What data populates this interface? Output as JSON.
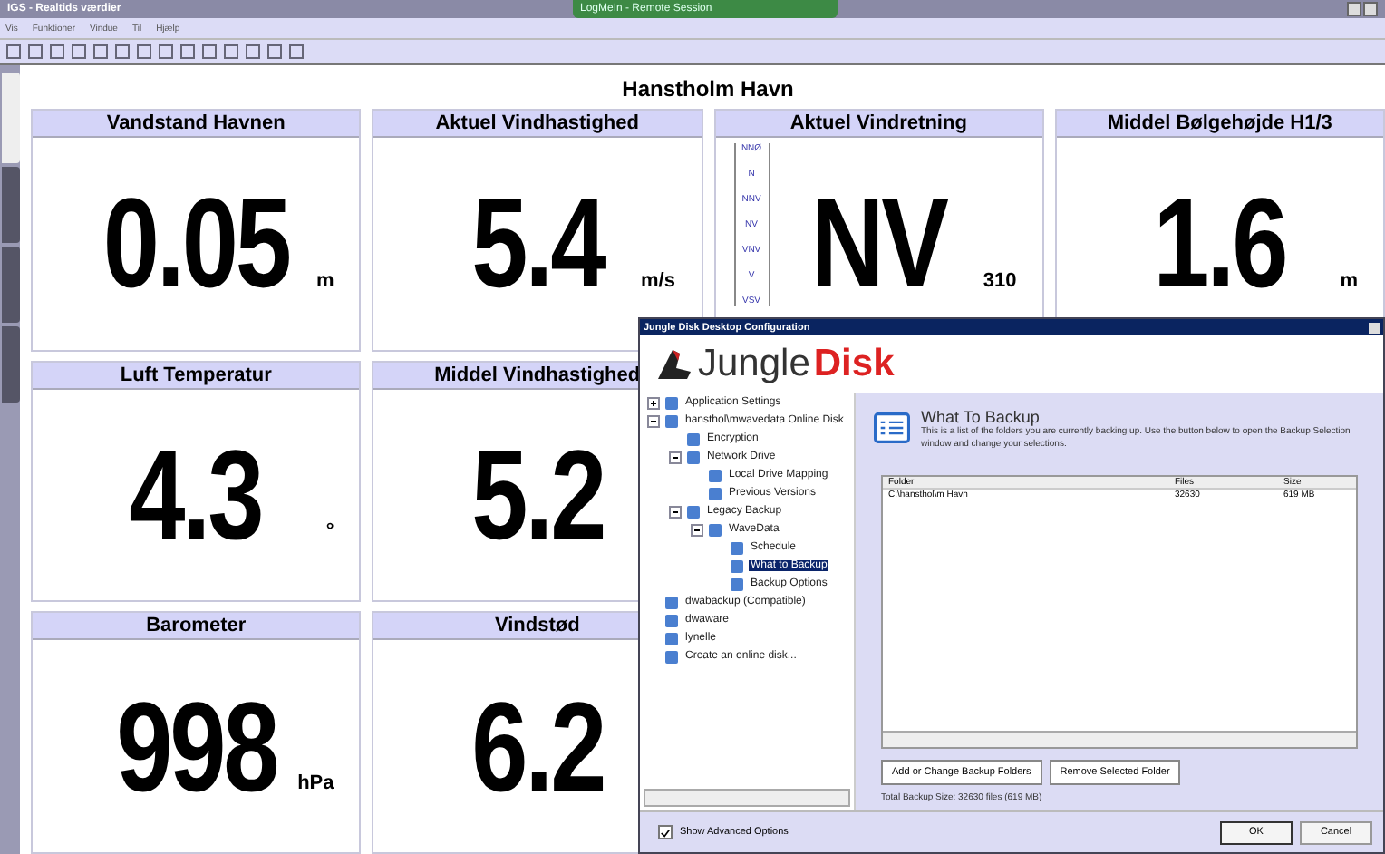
{
  "window": {
    "title": "IGS - Realtids værdier"
  },
  "remote_banner": {
    "title": "LogMeIn - Remote Session"
  },
  "menu": [
    "Vis",
    "Funktioner",
    "Vindue",
    "Til",
    "Hjælp"
  ],
  "heading": "Hanstholm Havn",
  "panels": [
    {
      "title": "Vandstand Havnen",
      "value": "0.05",
      "unit": "m",
      "kind": "plain"
    },
    {
      "title": "Aktuel Vindhastighed",
      "value": "5.4",
      "unit": "m/s",
      "kind": "plain"
    },
    {
      "title": "Aktuel Vindretning",
      "value": "NV",
      "unit": "310",
      "kind": "direction",
      "scale": [
        "NNØ",
        "N",
        "NNV",
        "NV",
        "VNV",
        "V",
        "VSV"
      ]
    },
    {
      "title": "Middel Bølgehøjde H1/3",
      "value": "1.6",
      "unit": "m",
      "kind": "plain"
    },
    {
      "title": "Luft Temperatur",
      "value": "4.3",
      "unit": "°",
      "kind": "plain"
    },
    {
      "title": "Middel Vindhastighed",
      "value": "5.2",
      "kind": "plain"
    },
    {
      "title": "Barometer",
      "value": "998",
      "unit": "hPa",
      "kind": "plain"
    },
    {
      "title": "Vindstød",
      "value": "6.2",
      "kind": "plain"
    }
  ],
  "side_tabs": [
    {
      "selected": true
    },
    {
      "selected": false
    },
    {
      "selected": false
    },
    {
      "selected": false
    }
  ],
  "dialog": {
    "title": "Jungle Disk Desktop Configuration",
    "logo": {
      "part_1": "Jungle",
      "part_2": "Disk"
    },
    "tree": [
      {
        "label": "Application Settings",
        "selected": false,
        "expanded": false
      },
      {
        "label": "hansthol\\mwavedata Online Disk",
        "selected": false,
        "expanded": true,
        "children": [
          {
            "label": "Encryption",
            "selected": false
          },
          {
            "label": "Network Drive",
            "selected": false,
            "expanded": true,
            "children": [
              {
                "label": "Local Drive Mapping",
                "selected": false
              },
              {
                "label": "Previous Versions",
                "selected": false
              }
            ]
          },
          {
            "label": "Legacy Backup",
            "selected": false,
            "expanded": true,
            "children": [
              {
                "label": "WaveData",
                "selected": false,
                "expanded": true,
                "children": [
                  {
                    "label": "Schedule",
                    "selected": false
                  },
                  {
                    "label": "What to Backup",
                    "selected": true
                  },
                  {
                    "label": "Backup Options",
                    "selected": false
                  }
                ]
              }
            ]
          }
        ]
      },
      {
        "label": "dwabackup (Compatible)",
        "selected": false
      },
      {
        "label": "dwaware",
        "selected": false
      },
      {
        "label": "lynelle",
        "selected": false
      },
      {
        "label": "Create an online disk...",
        "selected": false
      }
    ],
    "section_title": "What To Backup",
    "section_text": "This is a list of the folders you are currently backing up. Use the button below to open the Backup Selection window and change your selections.",
    "table": {
      "columns": [
        "Folder",
        "Files",
        "Size"
      ],
      "rows": [
        [
          "C:\\hansthol\\m Havn",
          "32630",
          "619 MB"
        ]
      ]
    },
    "buttons": [
      "Add or Change Backup Folders",
      "Remove Selected Folder"
    ],
    "total": "Total Backup Size: 32630 files (619 MB)",
    "show_advanced": {
      "label": "Show Advanced Options",
      "checked": true
    },
    "footer_buttons": [
      "OK",
      "Cancel"
    ]
  }
}
